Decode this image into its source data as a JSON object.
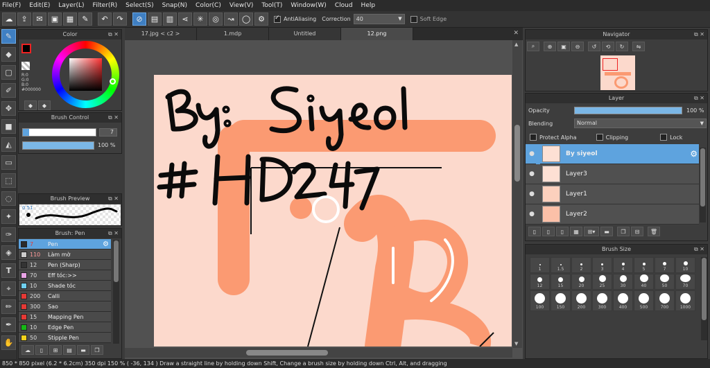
{
  "menu": [
    "File(F)",
    "Edit(E)",
    "Layer(L)",
    "Filter(R)",
    "Select(S)",
    "Snap(N)",
    "Color(C)",
    "View(V)",
    "Tool(T)",
    "Window(W)",
    "Cloud",
    "Help"
  ],
  "toolbar": {
    "antialias_label": "AntiAliasing",
    "correction_label": "Correction",
    "correction_value": "40",
    "soft_edge_label": "Soft Edge"
  },
  "color_panel": {
    "title": "Color",
    "r": "R:0",
    "g": "G:0",
    "b": "B:0",
    "hex": "#000000"
  },
  "brush_control": {
    "title": "Brush Control",
    "size": "7",
    "opacity": "100 %",
    "opacity_fraction": 1.0
  },
  "brush_preview": {
    "title": "Brush Preview",
    "size_label": "0.51"
  },
  "brush_list": {
    "title": "Brush: Pen",
    "items": [
      {
        "size": "7",
        "name": "Pen",
        "color": "#2b2b2b"
      },
      {
        "size": "110",
        "name": "Làm mờ",
        "color": "#cccccc"
      },
      {
        "size": "12",
        "name": "Pen (Sharp)",
        "color": "#333333"
      },
      {
        "size": "70",
        "name": "Eff tóc:>>",
        "color": "#e9a3e6"
      },
      {
        "size": "10",
        "name": "Shade tóc",
        "color": "#6fd0f0"
      },
      {
        "size": "200",
        "name": "Calli",
        "color": "#e53935"
      },
      {
        "size": "300",
        "name": "Sao",
        "color": "#e53935"
      },
      {
        "size": "15",
        "name": "Mapping Pen",
        "color": "#e53935"
      },
      {
        "size": "10",
        "name": "Edge Pen",
        "color": "#16b816"
      },
      {
        "size": "50",
        "name": "Stipple Pen",
        "color": "#f2d21b"
      }
    ]
  },
  "tabs": [
    "17.jpg < c2 >",
    "1.mdp",
    "Untitled",
    "12.png"
  ],
  "navigator": {
    "title": "Navigator"
  },
  "layer_panel": {
    "title": "Layer",
    "opacity_label": "Opacity",
    "opacity_value": "100 %",
    "opacity_fraction": 1.0,
    "blending_label": "Blending",
    "blending_value": "Normal",
    "protect_alpha": "Protect Alpha",
    "clipping": "Clipping",
    "lock": "Lock",
    "layers": [
      "By siyeol",
      "Layer3",
      "Layer1",
      "Layer2"
    ]
  },
  "brush_size": {
    "title": "Brush Size",
    "sizes": [
      "1",
      "1.5",
      "2",
      "3",
      "4",
      "5",
      "7",
      "10",
      "12",
      "15",
      "20",
      "25",
      "30",
      "40",
      "50",
      "70",
      "100",
      "150",
      "200",
      "300",
      "400",
      "500",
      "700",
      "1000"
    ]
  },
  "status": {
    "text": "850 * 850 pixel  (6.2 * 6.2cm)  350 dpi  150 %  ( -36, 134 )  Draw a straight line by holding down Shift, Change a brush size by holding down Ctrl, Alt, and dragging"
  },
  "colors": {
    "accent": "#5ea3de",
    "paper": "#fcd9cc",
    "peach": "#fb9a72"
  }
}
